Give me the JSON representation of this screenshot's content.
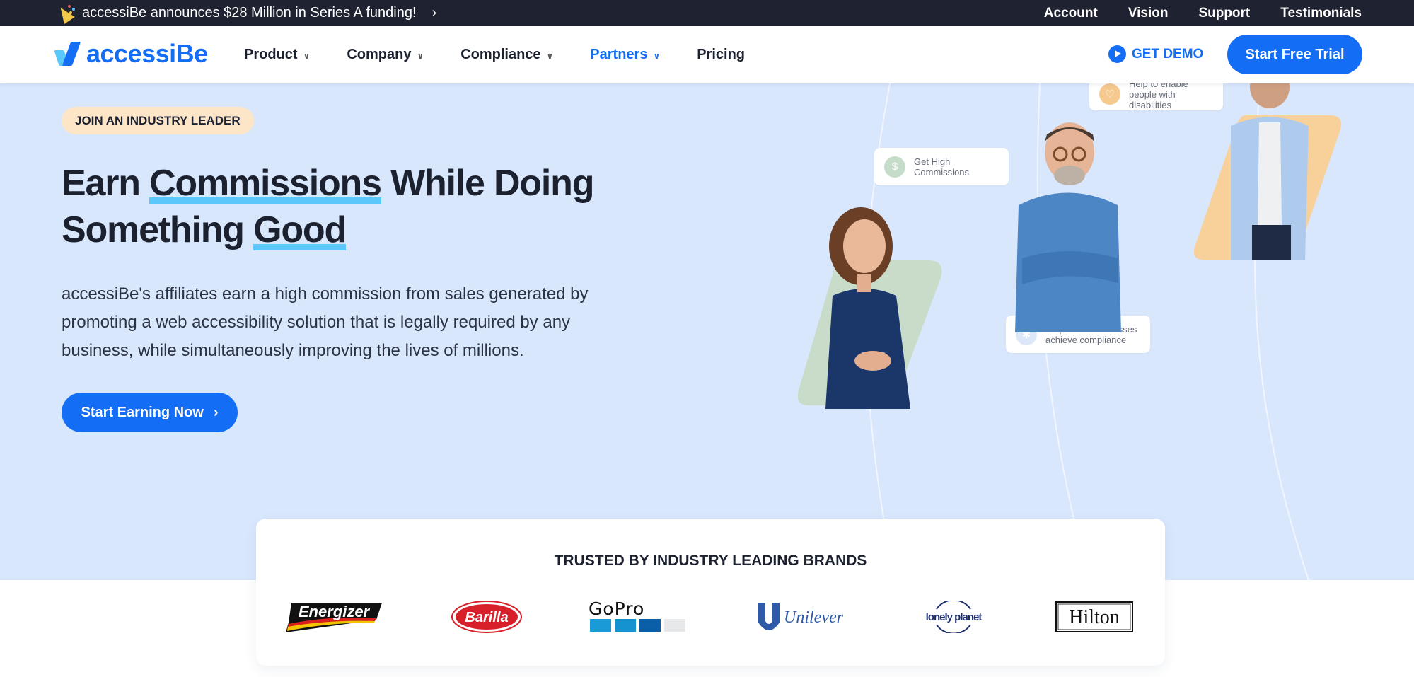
{
  "announcement": {
    "icon": "party-popper-icon",
    "text": "accessiBe announces $28 Million in Series A funding!",
    "chevron": "›"
  },
  "top_links": [
    "Account",
    "Vision",
    "Support",
    "Testimonials"
  ],
  "nav": {
    "logo_text": "accessiBe",
    "menu": [
      {
        "label": "Product",
        "dropdown": true,
        "active": false
      },
      {
        "label": "Company",
        "dropdown": true,
        "active": false
      },
      {
        "label": "Compliance",
        "dropdown": true,
        "active": false
      },
      {
        "label": "Partners",
        "dropdown": true,
        "active": true
      },
      {
        "label": "Pricing",
        "dropdown": false,
        "active": false
      }
    ],
    "chevron": "⌄",
    "get_demo_label": "GET DEMO",
    "trial_label": "Start Free Trial"
  },
  "hero": {
    "pill": "JOIN AN INDUSTRY LEADER",
    "headline": {
      "part1": "Earn ",
      "highlight1": "Commissions",
      "part2": " While Doing Something ",
      "highlight2": "Good"
    },
    "subtext": "accessiBe's affiliates earn a high commission from sales generated by promoting a web accessibility solution that is legally required by any business, while simultaneously improving the lives of millions.",
    "cta_label": "Start Earning Now",
    "cta_chevron": "›",
    "features": [
      {
        "text": "Get High Commissions",
        "icon": "dollar-icon",
        "glyph": "$"
      },
      {
        "text": "Help to enable people with disabilities",
        "icon": "heart-icon",
        "glyph": "♡"
      },
      {
        "text": "Help small businesses achieve compliance",
        "icon": "accessibility-icon",
        "glyph": "✱"
      }
    ]
  },
  "brands": {
    "title": "TRUSTED BY INDUSTRY LEADING BRANDS",
    "logos": [
      "Energizer",
      "Barilla",
      "GoPro",
      "Unilever",
      "lonely planet",
      "Hilton"
    ]
  },
  "colors": {
    "brand_blue": "#146ef5",
    "highlight": "#5ac8fa",
    "hero_bg": "#d9e7fd",
    "topbar_bg": "#1e2231",
    "pill_bg": "#fde5c8"
  }
}
